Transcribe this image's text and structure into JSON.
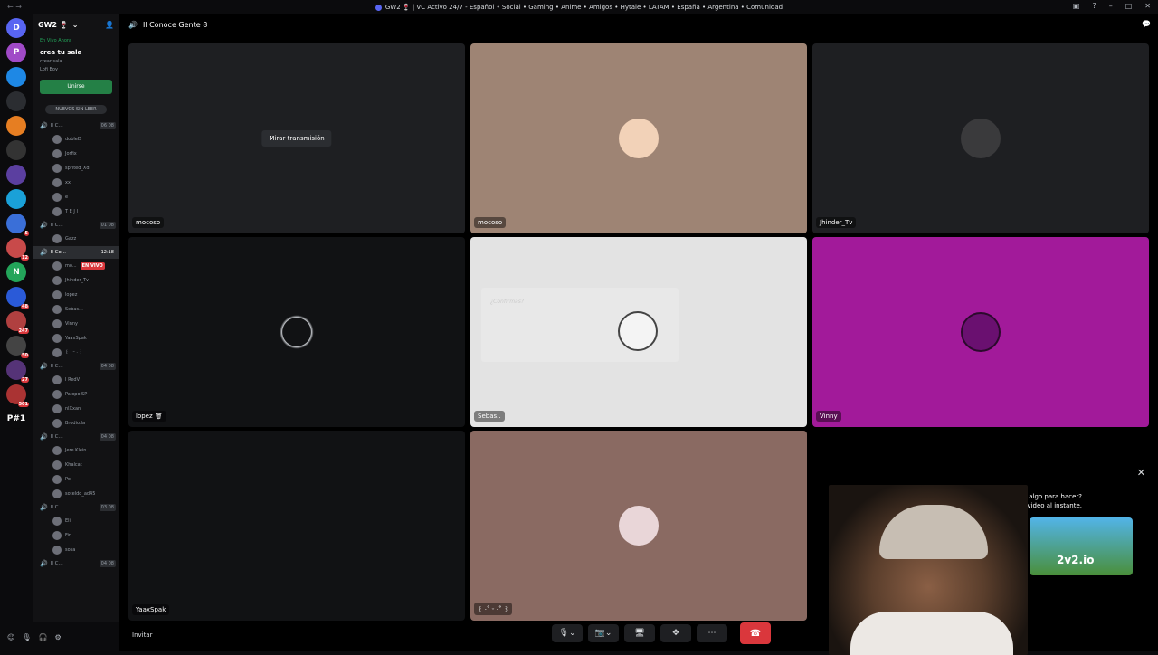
{
  "window": {
    "title": "GW2 🍷 | VC Activo 24/7 - Español • Social • Gaming • Anime • Amigos • Hytale • LATAM • España • Argentina • Comunidad"
  },
  "server": {
    "name": "GW2 🍷",
    "servers": [
      {
        "label": "D",
        "color": "#5865f2"
      },
      {
        "label": "P",
        "color": "#a04ac7"
      },
      {
        "label": "",
        "color": "#1e88e5",
        "badge": ""
      },
      {
        "label": "",
        "color": "#2b2d31"
      },
      {
        "label": "",
        "color": "#e67e22"
      },
      {
        "label": "",
        "color": "#333"
      },
      {
        "label": "",
        "color": "#5b3fa0"
      },
      {
        "label": "",
        "color": "#1aa1d8"
      },
      {
        "label": "",
        "color": "#3a6fd8",
        "badge": "5"
      },
      {
        "label": "",
        "color": "#c84a4a",
        "badge": "12"
      },
      {
        "label": "N",
        "color": "#23a55a"
      },
      {
        "label": "",
        "color": "#2a5ad8",
        "badge": "48"
      },
      {
        "label": "",
        "color": "#b04040",
        "badge": "247"
      },
      {
        "label": "",
        "color": "#444",
        "badge": "50"
      },
      {
        "label": "",
        "color": "#553377",
        "badge": "27"
      },
      {
        "label": "",
        "color": "#aa3333",
        "badge": "501"
      },
      {
        "label": "P#1",
        "color": "#0b0b0d"
      }
    ]
  },
  "sidebar": {
    "live_now": "En Vivo Ahora",
    "create_room": "crea tu sala",
    "create_room_sub": "crear sala",
    "lofi": "Lofi Boy",
    "join_button": "Unirse",
    "new_unread": "NUEVOS SIN LEER",
    "voice_channels": [
      {
        "name": "Il C...",
        "count": "06 08",
        "active": false,
        "members": [
          "dobleD",
          "Jorfix",
          "sprited_Xd",
          "xx",
          "e",
          "T E J I"
        ]
      },
      {
        "name": "Il C...",
        "count": "01 08",
        "active": false,
        "members": [
          "Gazz"
        ]
      },
      {
        "name": "Il Co...",
        "count": "12:18",
        "active": true,
        "members": [
          "mo...",
          "Jhinder_Tv",
          "lopez",
          "Sebas...",
          "Vinny",
          "YaaxSpak",
          "꒰ · ᵕ · ꒱"
        ]
      },
      {
        "name": "Il C...",
        "count": "04 08",
        "active": false,
        "members": [
          "I RedV",
          "Palopo.SP",
          "nlXxan",
          "Brodio.la"
        ]
      },
      {
        "name": "Il C...",
        "count": "04 08",
        "active": false,
        "members": [
          "Jere Klein",
          "Khalcat",
          "Poi",
          "soteldo_ad45"
        ]
      },
      {
        "name": "Il C...",
        "count": "03 08",
        "active": false,
        "members": [
          "Eli",
          "Fin",
          "sosa"
        ]
      },
      {
        "name": "Il C...",
        "count": "04 08",
        "active": false,
        "members": []
      }
    ],
    "live_badge": "EN VIVO"
  },
  "main": {
    "channel_name": "Il Conoce Gente 8",
    "watch_stream": "Mirar transmisión",
    "tiles": [
      {
        "name": "mocoso",
        "bg": "#1e1f22"
      },
      {
        "name": "mocoso",
        "bg": "#9e8474"
      },
      {
        "name": "Jhinder_Tv",
        "bg": "#1e1f22"
      },
      {
        "name": "lopez 🗑",
        "bg": "#111214"
      },
      {
        "name": "Sebas..",
        "bg": "#e3e3e3"
      },
      {
        "name": "Vinny",
        "bg": "#a21a9a"
      },
      {
        "name": "YaaxSpak",
        "bg": "#111214"
      },
      {
        "name": "꒰ ·˚ ᵕ ·˚ ꒱",
        "bg": "#8a6a62"
      }
    ],
    "popup_title": "¿Confirmas?",
    "invite": "Invitar"
  },
  "ad": {
    "text_line1": "¿Buscas algo para hacer?",
    "text_line2": "Comienza la reproducción de video al instante.",
    "thumb_label": "2v2.io"
  }
}
